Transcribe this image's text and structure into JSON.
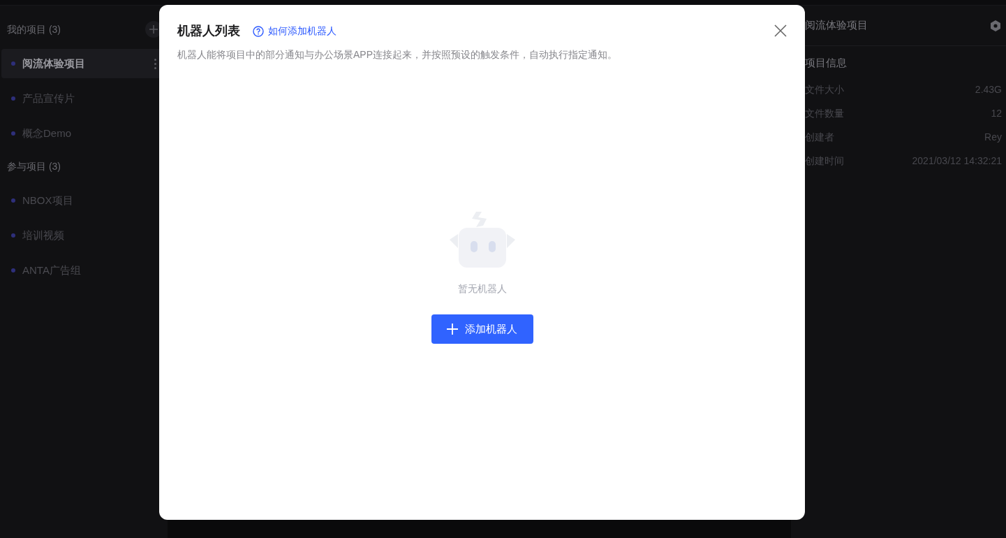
{
  "sidebar": {
    "my_projects": {
      "title": "我的项目 (3)",
      "items": [
        {
          "label": "阅流体验项目",
          "selected": true
        },
        {
          "label": "产品宣传片",
          "selected": false
        },
        {
          "label": "概念Demo",
          "selected": false
        }
      ]
    },
    "joined_projects": {
      "title": "参与项目 (3)",
      "items": [
        {
          "label": "NBOX项目",
          "selected": false
        },
        {
          "label": "培训视频",
          "selected": false
        },
        {
          "label": "ANTA广告组",
          "selected": false
        }
      ]
    }
  },
  "info_panel": {
    "title": "阅流体验项目",
    "section_title": "项目信息",
    "rows": [
      {
        "label": "文件大小",
        "value": "2.43G"
      },
      {
        "label": "文件数量",
        "value": "12"
      },
      {
        "label": "创建者",
        "value": "Rey"
      },
      {
        "label": "创建时间",
        "value": "2021/03/12 14:32:21"
      }
    ]
  },
  "dialog": {
    "title": "机器人列表",
    "help_link": "如何添加机器人",
    "description": "机器人能将项目中的部分通知与办公场景APP连接起来，并按照预设的触发条件，自动执行指定通知。",
    "empty_text": "暂无机器人",
    "add_button": "添加机器人"
  }
}
